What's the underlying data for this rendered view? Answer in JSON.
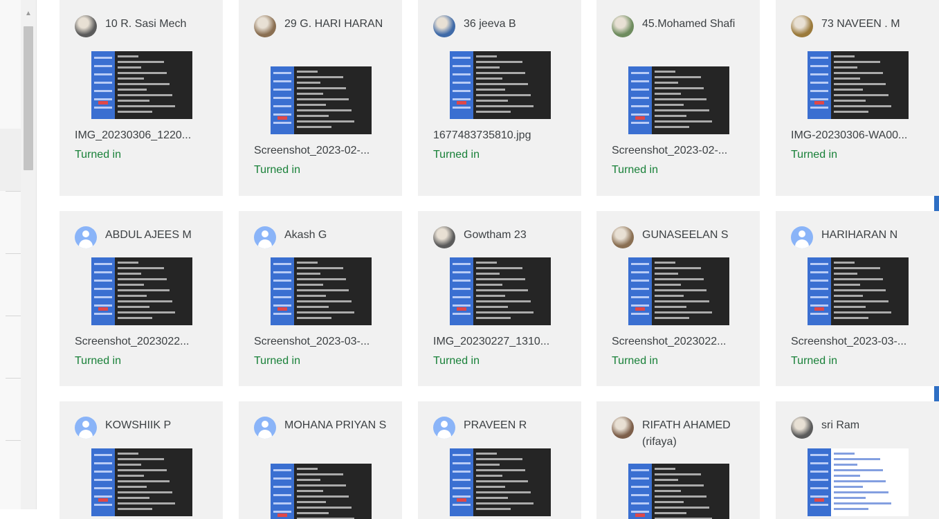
{
  "status_color": "#188038",
  "submissions": [
    {
      "name": "10 R. Sasi Mech",
      "avatar": "photo",
      "file": "IMG_20230306_1220...",
      "status": "Turned in"
    },
    {
      "name": "29 G. HARI HARAN",
      "avatar": "photo",
      "file": "Screenshot_2023-02-...",
      "status": "Turned in"
    },
    {
      "name": "36 jeeva B",
      "avatar": "photo",
      "file": "1677483735810.jpg",
      "status": "Turned in"
    },
    {
      "name": "45.Mohamed Shafi",
      "avatar": "photo",
      "file": "Screenshot_2023-02-...",
      "status": "Turned in"
    },
    {
      "name": "73 NAVEEN . M",
      "avatar": "photo",
      "file": "IMG-20230306-WA00...",
      "status": "Turned in"
    },
    {
      "name": "ABDUL AJEES M",
      "avatar": "default",
      "file": "Screenshot_2023022...",
      "status": "Turned in"
    },
    {
      "name": "Akash G",
      "avatar": "default",
      "file": "Screenshot_2023-03-...",
      "status": "Turned in"
    },
    {
      "name": "Gowtham 23",
      "avatar": "photo",
      "file": "IMG_20230227_1310...",
      "status": "Turned in"
    },
    {
      "name": "GUNASEELAN S",
      "avatar": "photo",
      "file": "Screenshot_2023022...",
      "status": "Turned in"
    },
    {
      "name": "HARIHARAN N",
      "avatar": "default",
      "file": "Screenshot_2023-03-...",
      "status": "Turned in"
    },
    {
      "name": "KOWSHIIK P",
      "avatar": "default"
    },
    {
      "name": "MOHANA PRIYAN S",
      "avatar": "default"
    },
    {
      "name": "PRAVEEN R",
      "avatar": "default"
    },
    {
      "name": "RIFATH AHAMED (rifaya)",
      "avatar": "photo"
    },
    {
      "name": "sri Ram",
      "avatar": "photo"
    }
  ]
}
